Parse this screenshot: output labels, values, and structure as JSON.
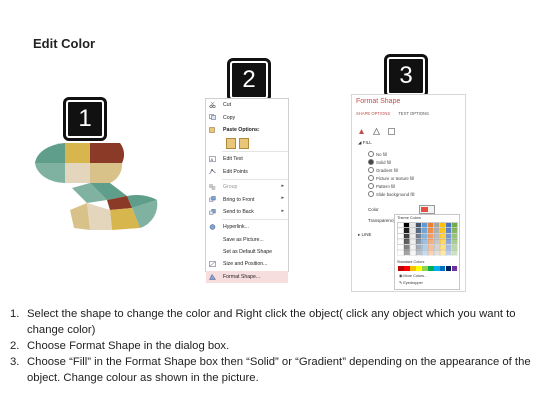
{
  "page": {
    "title": "Edit Color"
  },
  "badges": [
    "1",
    "2",
    "3"
  ],
  "context_menu": {
    "items": [
      {
        "label": "Cut",
        "icon": "scissors-icon"
      },
      {
        "label": "Copy",
        "icon": "copy-icon"
      },
      {
        "label": "Paste Options:",
        "icon": "paste-icon"
      },
      {
        "label": "Edit Text",
        "icon": "edit-text-icon"
      },
      {
        "label": "Edit Points",
        "icon": "edit-points-icon"
      },
      {
        "label": "Group",
        "icon": "group-icon"
      },
      {
        "label": "Bring to Front",
        "icon": "bring-front-icon"
      },
      {
        "label": "Send to Back",
        "icon": "send-back-icon"
      },
      {
        "label": "Hyperlink...",
        "icon": "hyperlink-icon"
      },
      {
        "label": "Save as Picture...",
        "icon": ""
      },
      {
        "label": "Set as Default Shape",
        "icon": ""
      },
      {
        "label": "Size and Position...",
        "icon": "size-position-icon"
      },
      {
        "label": "Format Shape...",
        "icon": "format-shape-icon"
      }
    ]
  },
  "format_pane": {
    "title": "Format Shape",
    "tabs": [
      "SHAPE OPTIONS",
      "TEXT OPTIONS"
    ],
    "fill_label": "FILL",
    "options": [
      "No fill",
      "Solid fill",
      "Gradient fill",
      "Picture or texture fill",
      "Pattern fill",
      "Slide background fill"
    ],
    "color_label": "Color",
    "transparency_label": "Transparency",
    "line_label": "LINE",
    "palette": {
      "theme_label": "Theme Colors",
      "standard_label": "Standard Colors",
      "more_label": "More Colors...",
      "eyedropper_label": "Eyedropper"
    }
  },
  "colors": {
    "teal": "#5f9e8a",
    "khaki": "#d8c28a",
    "gold": "#d8b64e",
    "brown": "#8a3a26",
    "beige": "#e3d6bd",
    "accent_red": "#c0504d"
  },
  "instructions": [
    {
      "num": "1.",
      "text": "Select the shape to change the color and Right click the object( click any object which you want to change color)"
    },
    {
      "num": "2.",
      "text": "Choose Format Shape in the dialog box."
    },
    {
      "num": "3.",
      "text": "Choose “Fill” in the Format Shape box then “Solid” or “Gradient” depending on the appearance of the object. Change colour as shown in the picture."
    }
  ]
}
